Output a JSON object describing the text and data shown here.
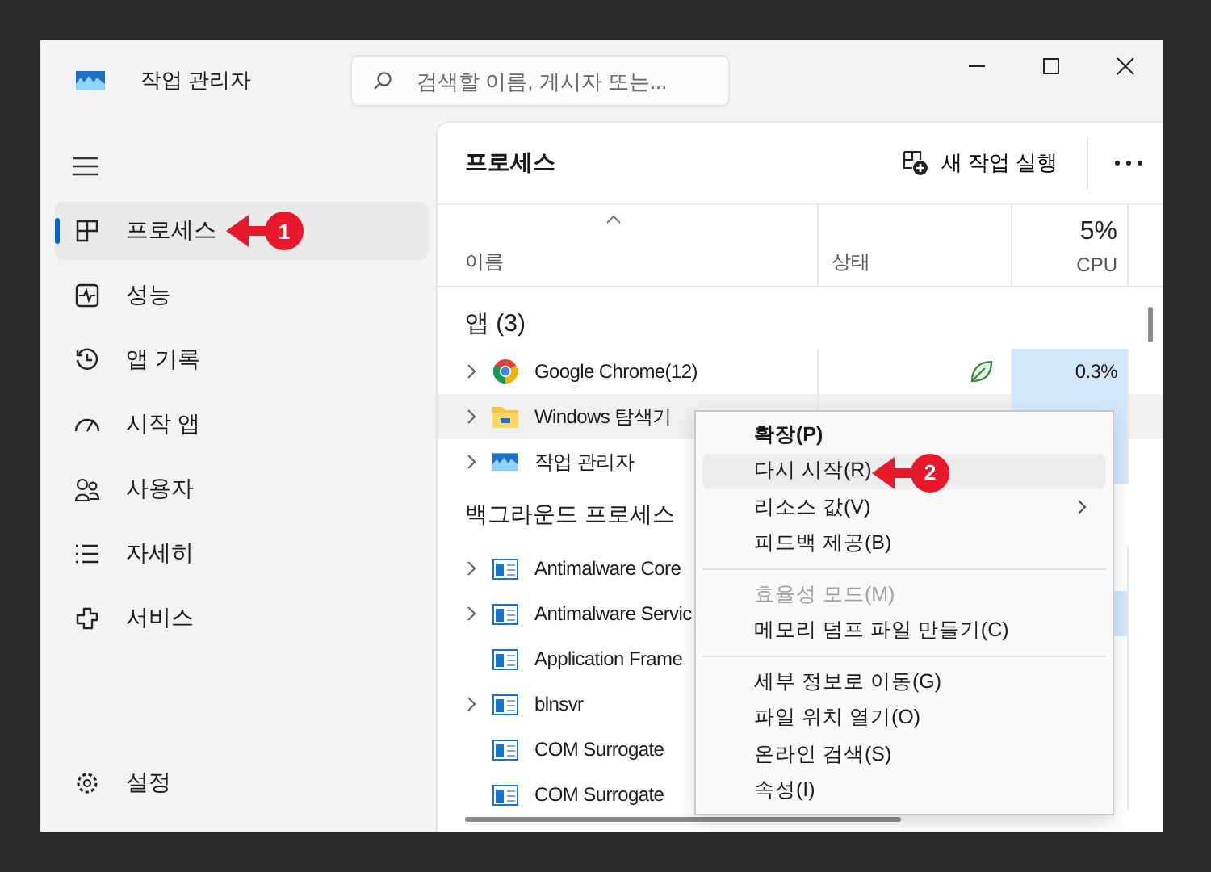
{
  "window": {
    "title": "작업 관리자",
    "search": {
      "placeholder": "검색할 이름, 게시자 또는..."
    }
  },
  "sidebar": {
    "items": [
      {
        "label": "프로세스",
        "selected": true,
        "callout": "1"
      },
      {
        "label": "성능",
        "selected": false
      },
      {
        "label": "앱 기록",
        "selected": false
      },
      {
        "label": "시작 앱",
        "selected": false
      },
      {
        "label": "사용자",
        "selected": false
      },
      {
        "label": "자세히",
        "selected": false
      },
      {
        "label": "서비스",
        "selected": false
      }
    ],
    "footer": {
      "label": "설정"
    }
  },
  "toolbar": {
    "title": "프로세스",
    "action": "새 작업 실행"
  },
  "table": {
    "columns": [
      {
        "label": "이름"
      },
      {
        "label": "상태"
      },
      {
        "label": "CPU",
        "total": "5%"
      }
    ],
    "groups": [
      {
        "title": "앱 (3)",
        "rows": [
          {
            "name": "Google Chrome(12)",
            "kind": "browser",
            "expandable": true,
            "efficiency": true,
            "cpu": "0.3%",
            "highlighted": true,
            "selected": false
          },
          {
            "name": "Windows 탐색기",
            "kind": "folder",
            "expandable": true,
            "efficiency": false,
            "highlighted": true,
            "selected": true
          },
          {
            "name": "작업 관리자",
            "kind": "monitor",
            "expandable": true,
            "efficiency": false,
            "highlighted": true,
            "selected": false
          }
        ]
      },
      {
        "title": "백그라운드 프로세스",
        "rows": [
          {
            "name": "Antimalware Core",
            "kind": "service",
            "expandable": true,
            "highlighted": false,
            "selected": false
          },
          {
            "name": "Antimalware Servic",
            "kind": "service",
            "expandable": true,
            "highlighted": true,
            "selected": false
          },
          {
            "name": "Application Frame",
            "kind": "service",
            "expandable": false,
            "highlighted": false,
            "selected": false
          },
          {
            "name": "blnsvr",
            "kind": "service",
            "expandable": true,
            "highlighted": false,
            "selected": false
          },
          {
            "name": "COM Surrogate",
            "kind": "service",
            "expandable": false,
            "highlighted": false,
            "selected": false
          },
          {
            "name": "COM Surrogate",
            "kind": "service",
            "expandable": false,
            "highlighted": false,
            "selected": false
          }
        ]
      }
    ]
  },
  "context_menu": {
    "sections": [
      [
        {
          "label": "확장(P)",
          "kind": "default",
          "submenu": false,
          "selected": false
        },
        {
          "label": "다시 시작(R)",
          "kind": "normal",
          "submenu": false,
          "selected": true,
          "callout": "2"
        },
        {
          "label": "리소스 값(V)",
          "kind": "normal",
          "submenu": true,
          "selected": false
        },
        {
          "label": "피드백 제공(B)",
          "kind": "normal",
          "submenu": false,
          "selected": false
        }
      ],
      [
        {
          "label": "효율성 모드(M)",
          "kind": "disabled",
          "submenu": false,
          "selected": false
        },
        {
          "label": "메모리 덤프 파일 만들기(C)",
          "kind": "normal",
          "submenu": false,
          "selected": false
        }
      ],
      [
        {
          "label": "세부 정보로 이동(G)",
          "kind": "normal",
          "submenu": false,
          "selected": false
        },
        {
          "label": "파일 위치 열기(O)",
          "kind": "normal",
          "submenu": false,
          "selected": false
        },
        {
          "label": "온라인 검색(S)",
          "kind": "normal",
          "submenu": false,
          "selected": false
        },
        {
          "label": "속성(I)",
          "kind": "normal",
          "submenu": false,
          "selected": false
        }
      ]
    ]
  }
}
